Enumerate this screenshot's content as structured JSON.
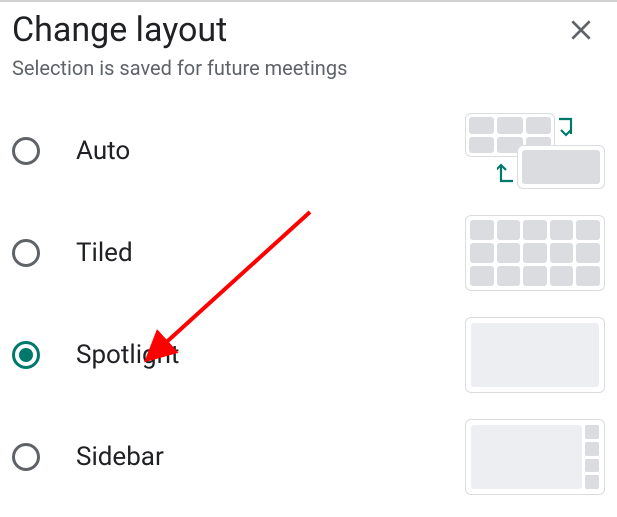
{
  "dialog": {
    "title": "Change layout",
    "subtitle": "Selection is saved for future meetings"
  },
  "options": [
    {
      "id": "auto",
      "label": "Auto",
      "selected": false
    },
    {
      "id": "tiled",
      "label": "Tiled",
      "selected": false
    },
    {
      "id": "spotlight",
      "label": "Spotlight",
      "selected": true
    },
    {
      "id": "sidebar",
      "label": "Sidebar",
      "selected": false
    }
  ],
  "colors": {
    "accent": "#00796b",
    "text_primary": "#202124",
    "text_secondary": "#5f6368",
    "border": "#dadce0",
    "annotation_arrow": "#ff0000"
  }
}
